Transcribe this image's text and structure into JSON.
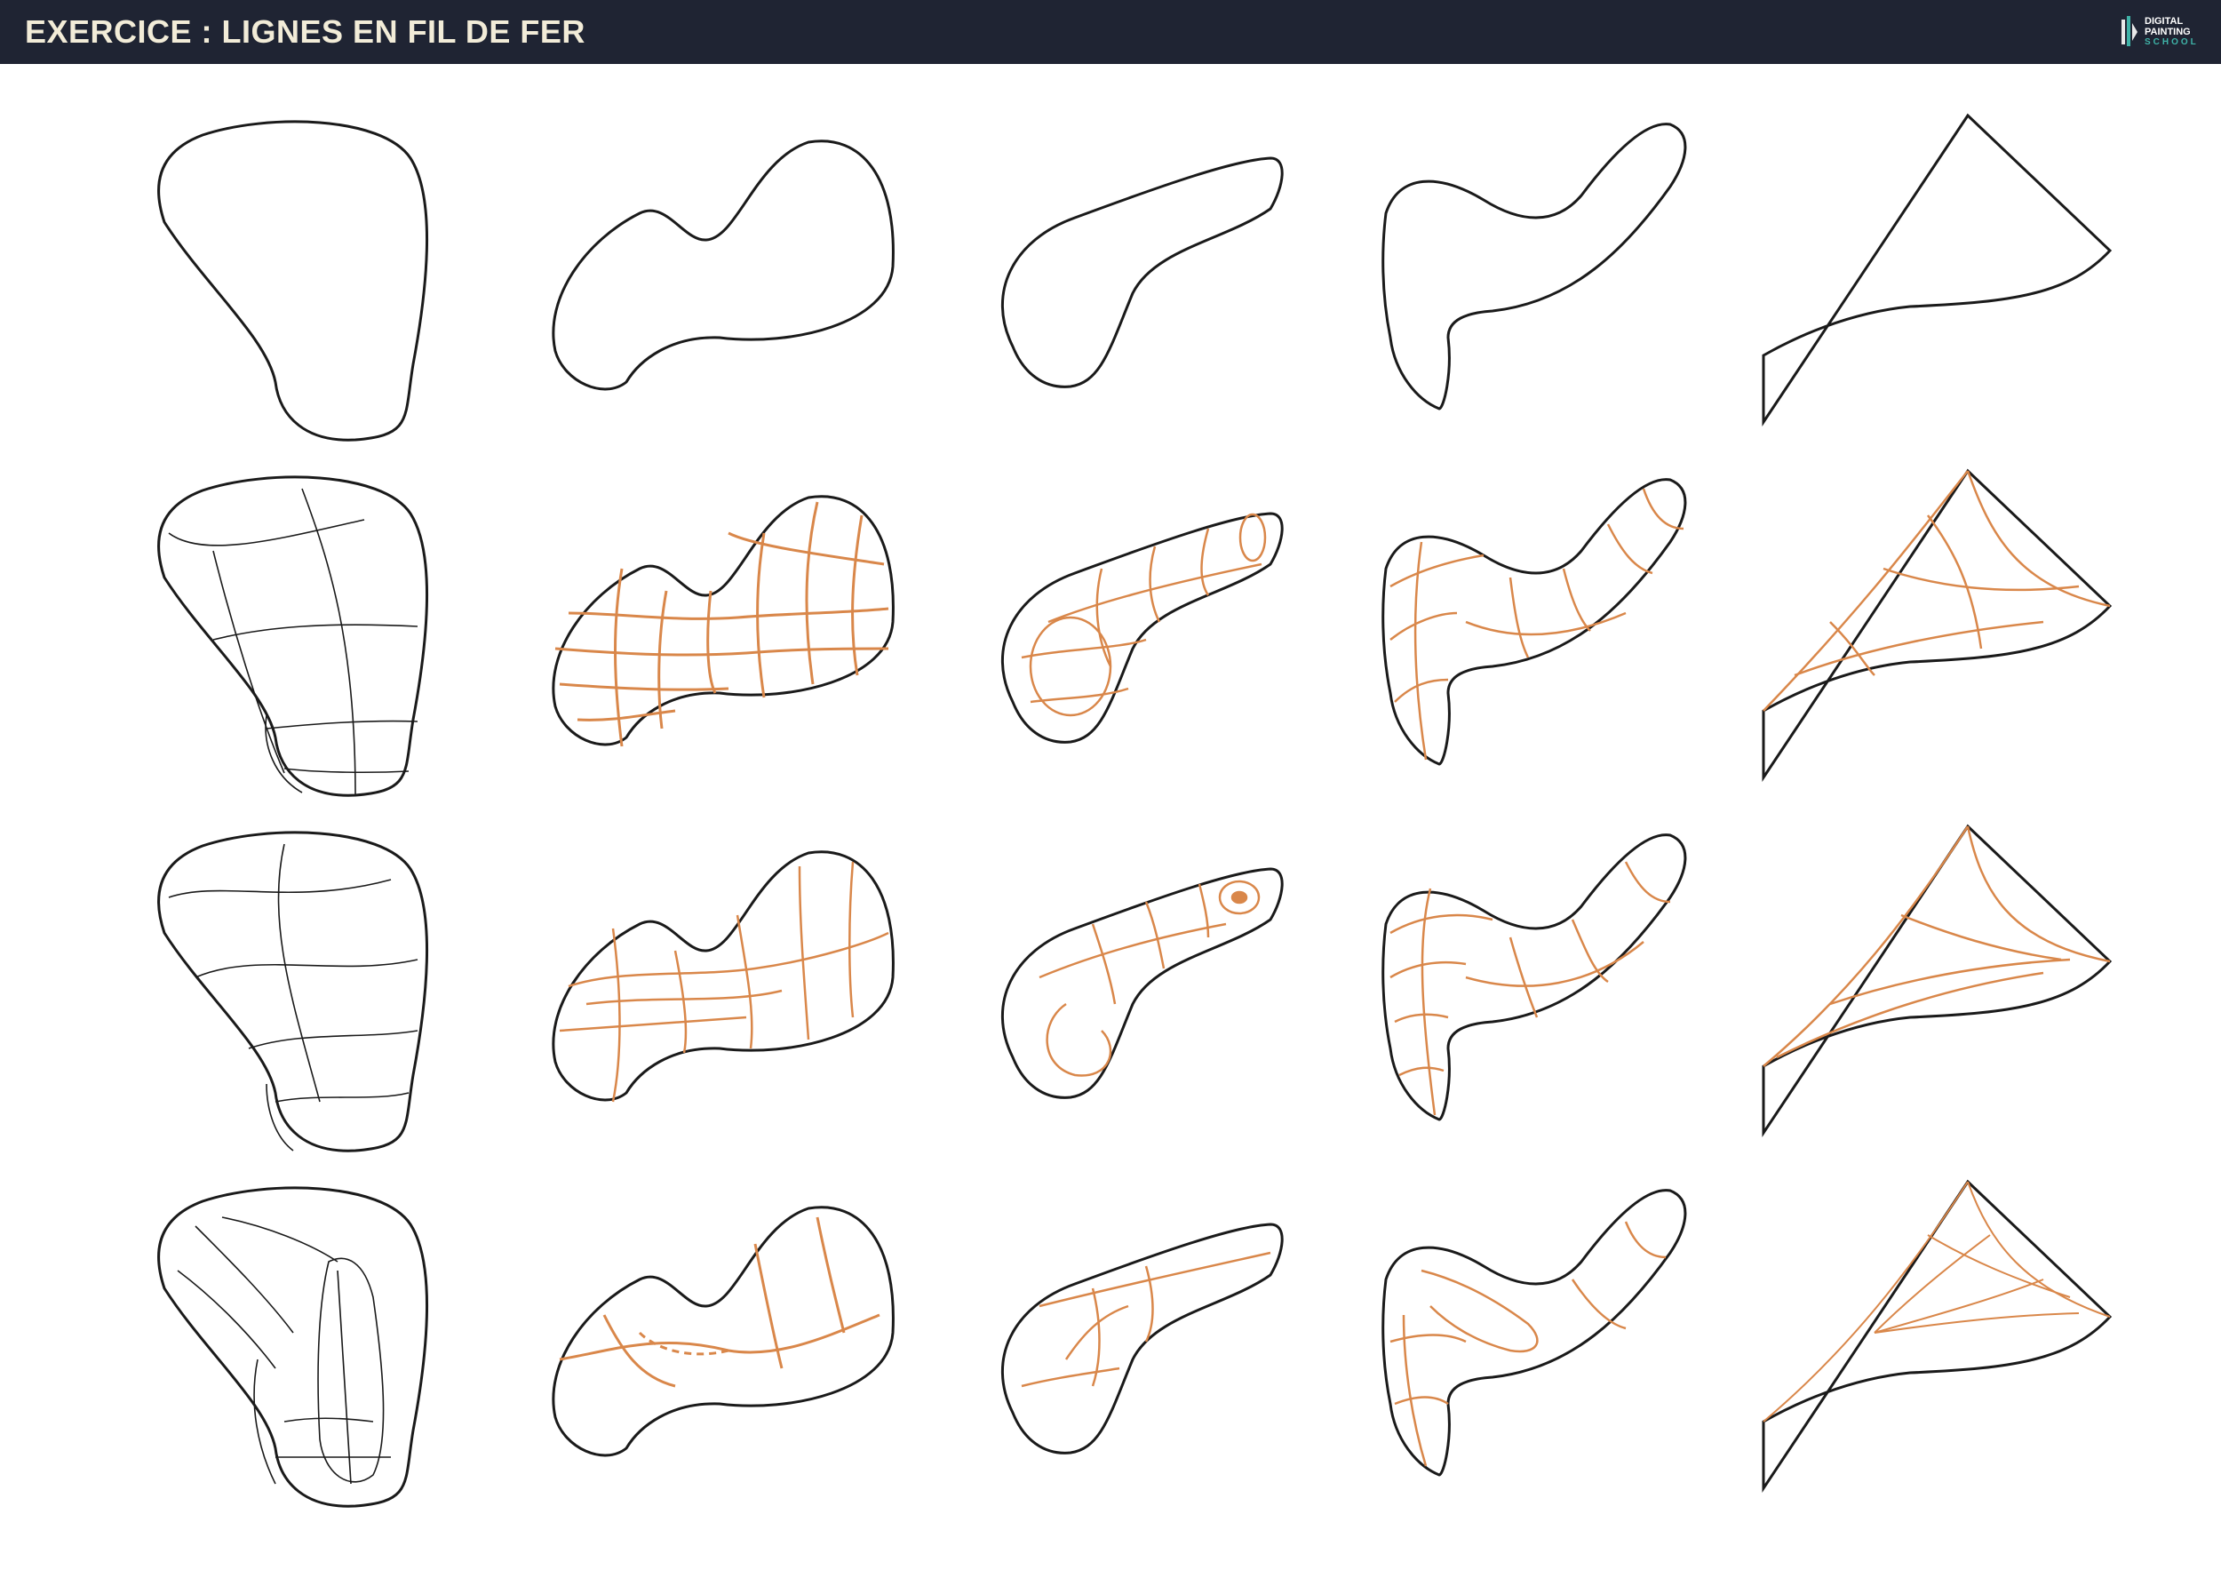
{
  "header": {
    "title": "EXERCICE : LIGNES EN FIL DE FER",
    "logo": {
      "line1": "DIGITAL",
      "line2": "PAINTING",
      "line3": "SCHOOL",
      "icon": "brush-logo-icon"
    }
  },
  "colors": {
    "header_bg": "#1f2433",
    "title_text": "#f2ecd8",
    "outline": "#1a1a1a",
    "wireframe_orange": "#d9874a",
    "logo_accent": "#3fb3a8"
  },
  "grid": {
    "rows": 4,
    "columns": 5,
    "row_labels": [
      "outline",
      "wireframe-a",
      "wireframe-b",
      "wireframe-c"
    ]
  }
}
